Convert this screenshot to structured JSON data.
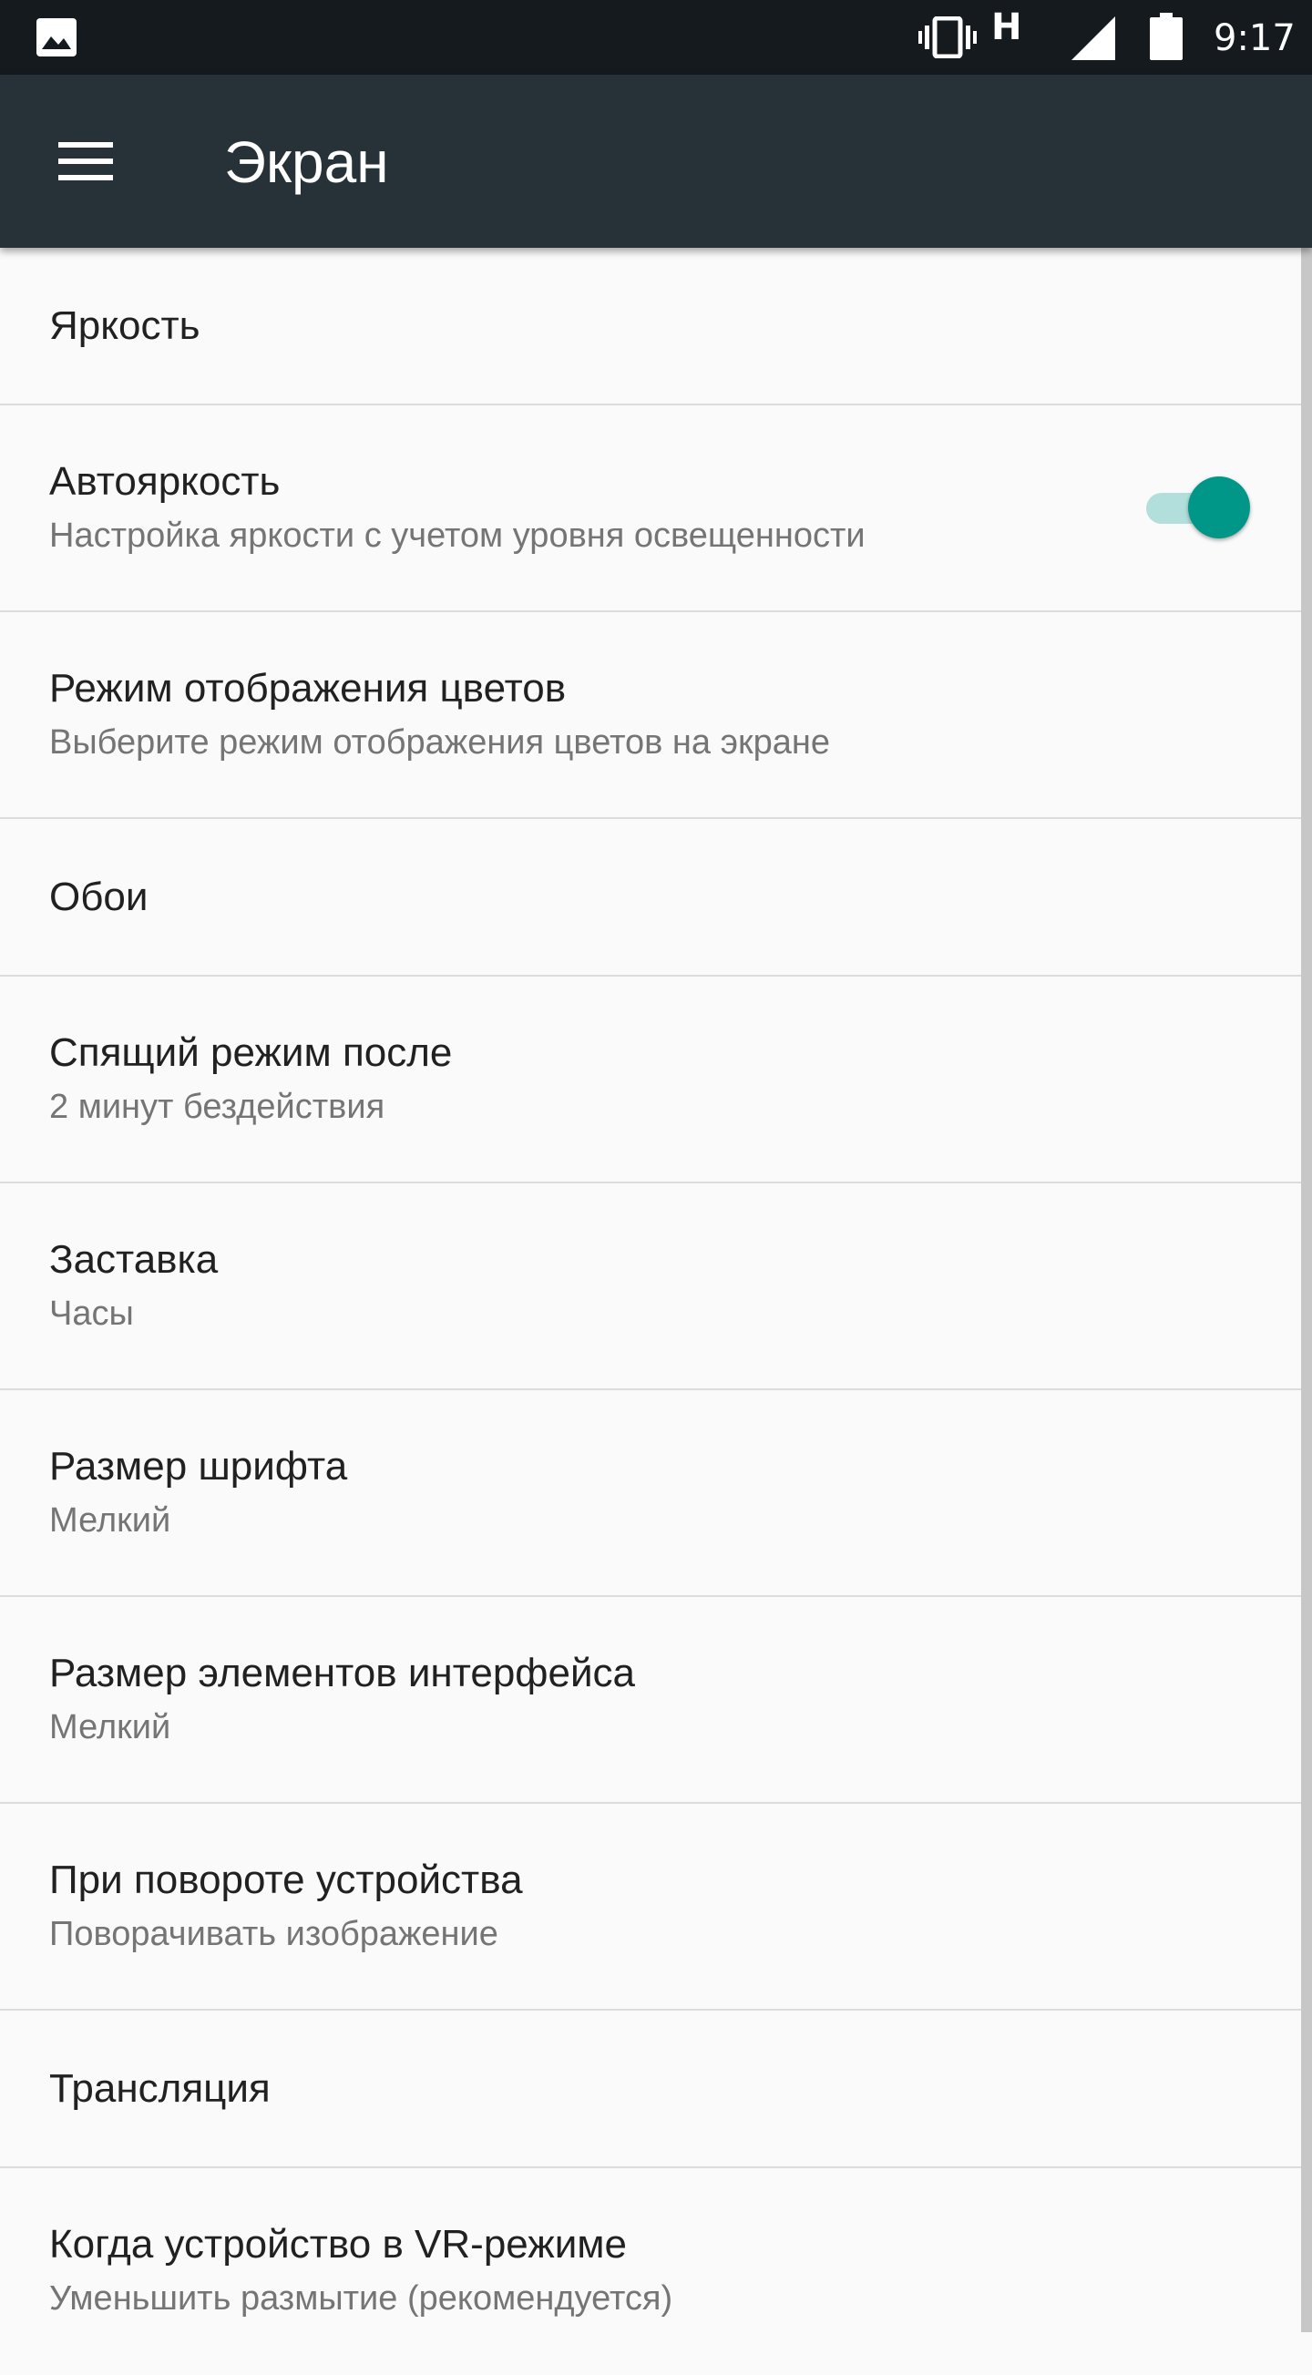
{
  "status_bar": {
    "icons": [
      "gallery-icon",
      "vibrate-icon",
      "signal-icon",
      "battery-icon"
    ],
    "network_label": "H",
    "time": "9:17"
  },
  "app_bar": {
    "menu_icon": "hamburger-menu-icon",
    "title": "Экран",
    "background_color": "#263238"
  },
  "accent_color": "#009688",
  "settings": [
    {
      "title": "Яркость"
    },
    {
      "title": "Автояркость",
      "summary": "Настройка яркости с учетом уровня освещенности",
      "toggle_on": true
    },
    {
      "title": "Режим отображения цветов",
      "summary": "Выберите режим отображения цветов на экране"
    },
    {
      "title": "Обои"
    },
    {
      "title": "Спящий режим после",
      "summary": "2 минут бездействия"
    },
    {
      "title": "Заставка",
      "summary": "Часы"
    },
    {
      "title": "Размер шрифта",
      "summary": "Мелкий"
    },
    {
      "title": "Размер элементов интерфейса",
      "summary": "Мелкий"
    },
    {
      "title": "При повороте устройства",
      "summary": "Поворачивать изображение"
    },
    {
      "title": "Трансляция"
    },
    {
      "title": "Когда устройство в VR-режиме",
      "summary": "Уменьшить размытие (рекомендуется)"
    }
  ]
}
